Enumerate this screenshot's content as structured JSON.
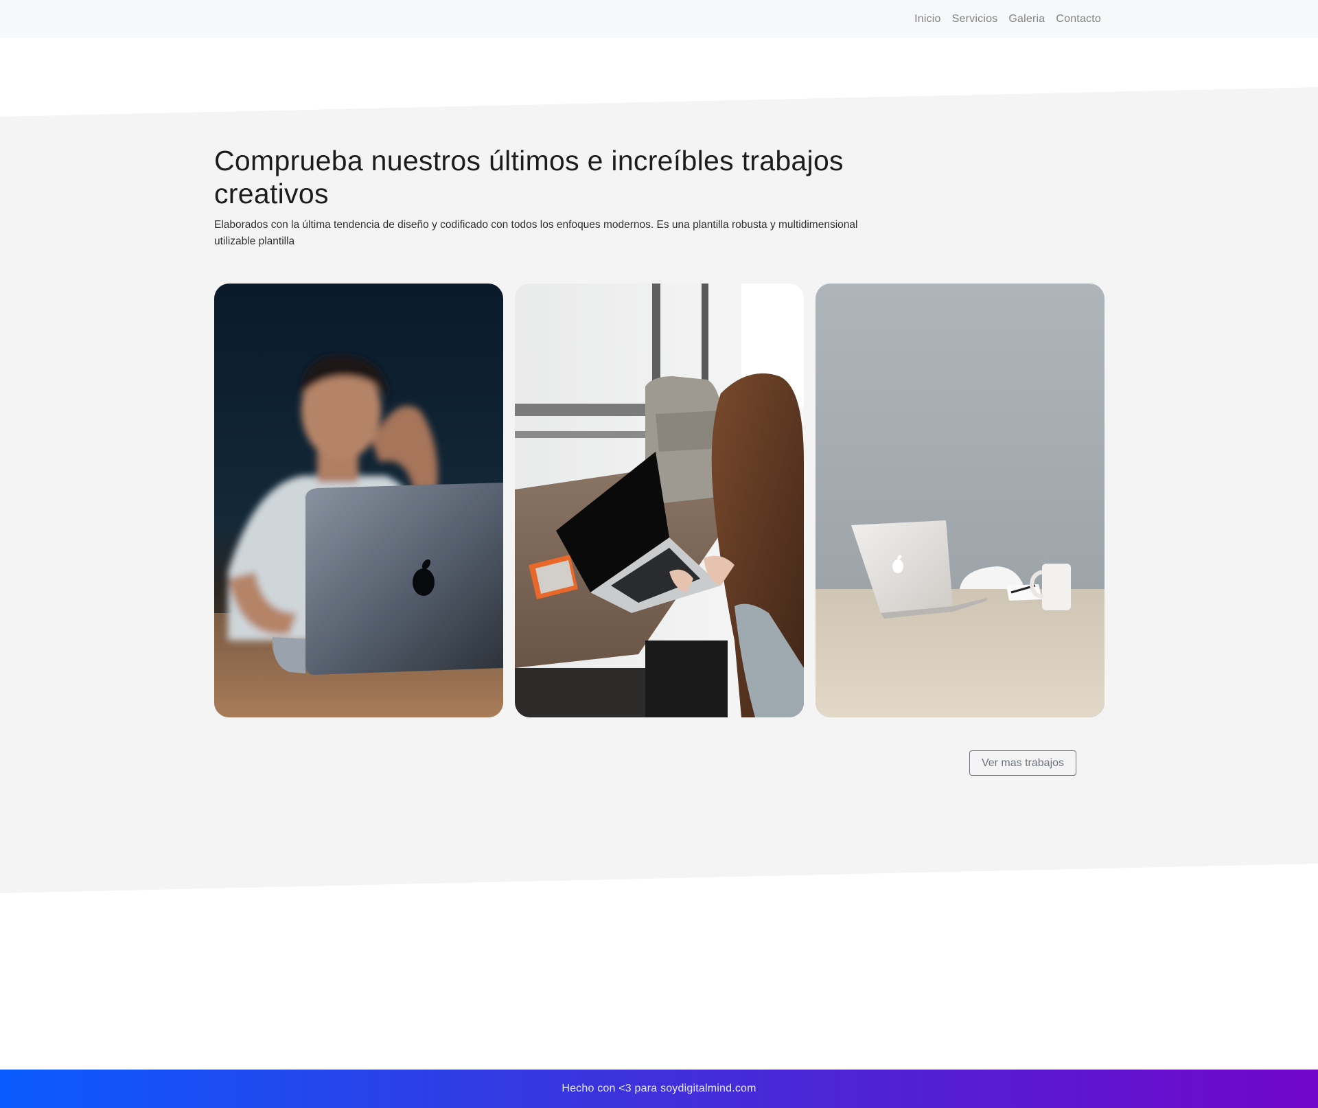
{
  "nav": {
    "items": [
      "Inicio",
      "Servicios",
      "Galeria",
      "Contacto"
    ]
  },
  "gallery": {
    "heading": "Comprueba nuestros últimos e increíbles trabajos creativos",
    "subtitle": "Elaborados con la última tendencia de diseño y codificado con todos los enfoques modernos. Es una plantilla robusta y multidimensional utilizable plantilla",
    "more_button": "Ver mas trabajos",
    "images": [
      "man-with-laptop-photo",
      "woman-working-at-window-photo",
      "laptop-on-table-photo"
    ]
  },
  "footer": {
    "text": "Hecho con <3 para soydigitalmind.com"
  },
  "colors": {
    "nav_bg": "#f7f8f9",
    "section_bg": "#f4f4f4",
    "footer_start": "#0a5bff",
    "footer_end": "#7106c9"
  }
}
